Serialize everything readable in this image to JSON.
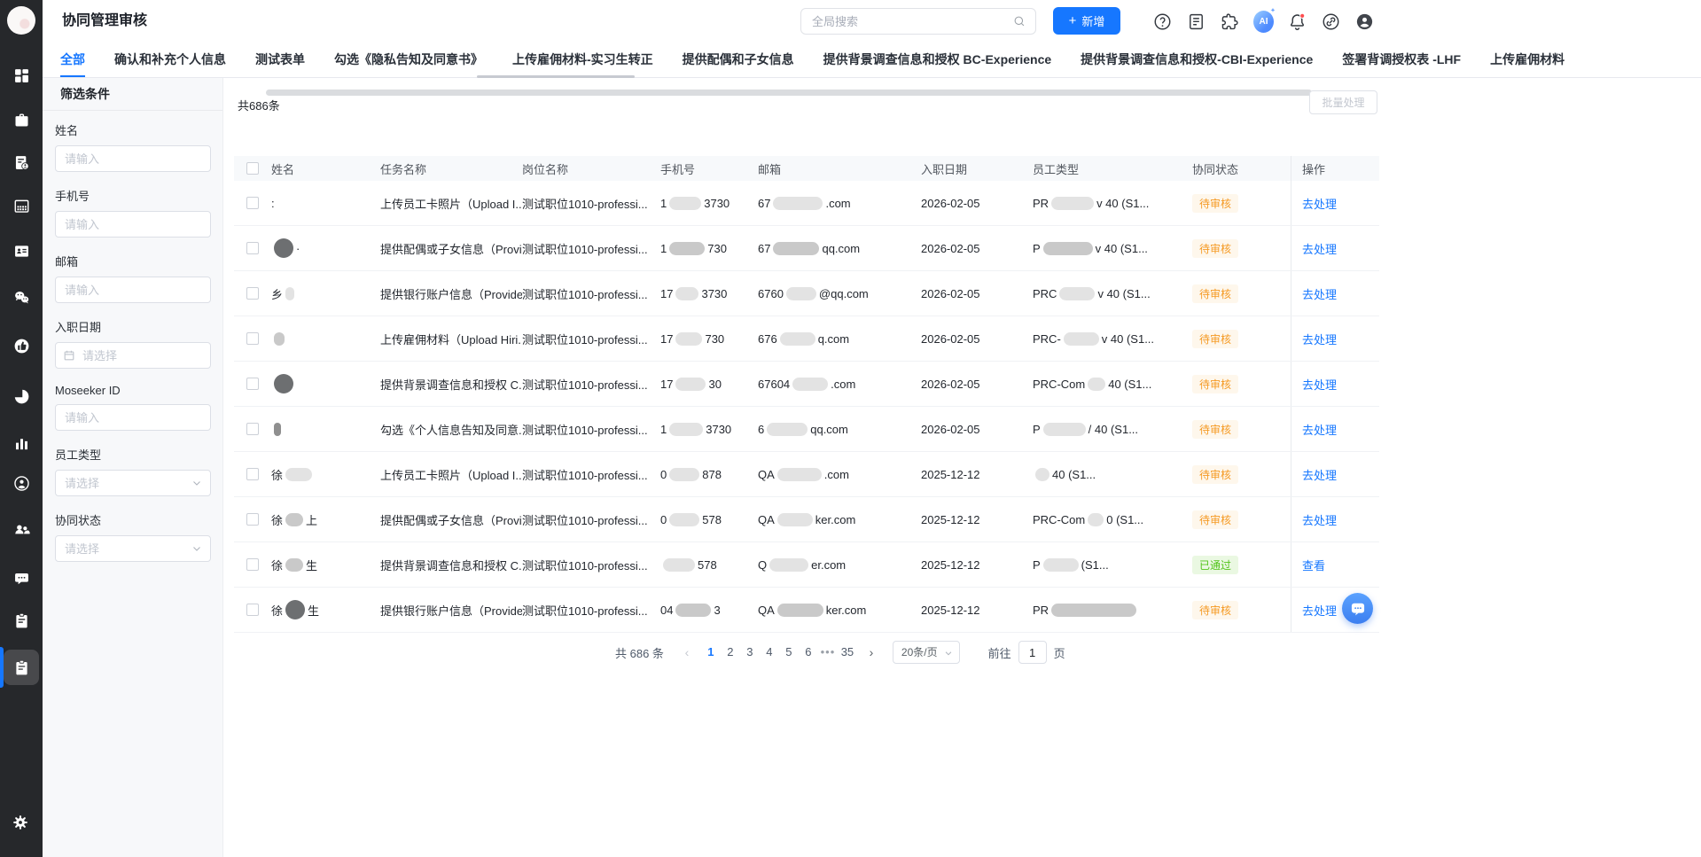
{
  "app": {
    "title": "协同管理审核"
  },
  "header": {
    "search": {
      "placeholder": "全局搜索"
    },
    "new_button": "新增",
    "ai_label": "AI",
    "icons": [
      "help",
      "document",
      "puzzle",
      "ai",
      "bell",
      "link",
      "user"
    ]
  },
  "sidebar": {
    "items": [
      {
        "name": "dashboard",
        "icon": "grid"
      },
      {
        "name": "positions",
        "icon": "briefcase"
      },
      {
        "name": "resumes",
        "icon": "doc-user"
      },
      {
        "name": "schedule",
        "icon": "calendar"
      },
      {
        "name": "id-card",
        "icon": "id-card"
      },
      {
        "name": "wechat",
        "icon": "wechat"
      },
      {
        "name": "endorsement",
        "icon": "thumb"
      },
      {
        "name": "pie-report",
        "icon": "pie"
      },
      {
        "name": "bar-report",
        "icon": "bars"
      },
      {
        "name": "candidate",
        "icon": "user-circle"
      },
      {
        "name": "talent-search",
        "icon": "users"
      },
      {
        "name": "messages",
        "icon": "chat"
      },
      {
        "name": "forms",
        "icon": "clipboard"
      },
      {
        "name": "approvals",
        "icon": "clipboard",
        "active": true
      }
    ],
    "bottom": {
      "name": "settings",
      "icon": "gear"
    }
  },
  "tabs": {
    "active_index": 0,
    "items": [
      "全部",
      "确认和补充个人信息",
      "测试表单",
      "勾选《隐私告知及同意书》",
      "上传雇佣材料-实习生转正",
      "提供配偶和子女信息",
      "提供背景调查信息和授权 BC-Experience",
      "提供背景调查信息和授权-CBI-Experience",
      "签署背调授权表 -LHF",
      "上传雇佣材料"
    ]
  },
  "filter": {
    "title": "筛选条件",
    "fields": [
      {
        "label": "姓名",
        "placeholder": "请输入",
        "type": "text"
      },
      {
        "label": "手机号",
        "placeholder": "请输入",
        "type": "text"
      },
      {
        "label": "邮箱",
        "placeholder": "请输入",
        "type": "text"
      },
      {
        "label": "入职日期",
        "placeholder": "请选择",
        "type": "date"
      },
      {
        "label": "Moseeker ID",
        "placeholder": "请输入",
        "type": "text"
      },
      {
        "label": "员工类型",
        "placeholder": "请选择",
        "type": "select"
      },
      {
        "label": "协同状态",
        "placeholder": "请选择",
        "type": "select"
      }
    ]
  },
  "table": {
    "total_text": "共686条",
    "batch_button": "批量处理",
    "columns": [
      "姓名",
      "任务名称",
      "岗位名称",
      "手机号",
      "邮箱",
      "入职日期",
      "员工类型",
      "协同状态",
      "操作"
    ],
    "status_kinds": {
      "待审核": "pending",
      "已通过": "passed"
    },
    "rows": [
      {
        "name": {
          "pre": ":"
        },
        "task": "上传员工卡照片（Upload I...",
        "position": "测试职位1010-professi...",
        "phone": {
          "pre": "1",
          "blob": 36,
          "post": "3730"
        },
        "email": {
          "pre": "67",
          "blob": 56,
          "post": ".com"
        },
        "hire_date": "2026-02-05",
        "employee_type": {
          "pre": "PR",
          "blob": 48,
          "post": "v 40 (S1..."
        },
        "status": "待审核",
        "action": "去处理"
      },
      {
        "name": {
          "blob": 22,
          "shape": "circle",
          "post": "·"
        },
        "task": "提供配偶或子女信息（Provi...",
        "position": "测试职位1010-professi...",
        "phone": {
          "pre": "1",
          "blob": 40,
          "post": "730",
          "shade": "mid"
        },
        "email": {
          "pre": "67",
          "blob": 52,
          "post": "qq.com",
          "shade": "mid"
        },
        "hire_date": "2026-02-05",
        "employee_type": {
          "pre": "P",
          "blob": 56,
          "post": "v 40 (S1...",
          "shade": "mid"
        },
        "status": "待审核",
        "action": "去处理"
      },
      {
        "name": {
          "pre": "乡",
          "blob": 10
        },
        "task": "提供银行账户信息（Provide...",
        "position": "测试职位1010-professi...",
        "phone": {
          "pre": "17",
          "blob": 26,
          "post": "3730"
        },
        "email": {
          "pre": "6760",
          "blob": 34,
          "post": "@qq.com"
        },
        "hire_date": "2026-02-05",
        "employee_type": {
          "pre": "PRC",
          "blob": 40,
          "post": "v 40 (S1..."
        },
        "status": "待审核",
        "action": "去处理"
      },
      {
        "name": {
          "blob": 12,
          "shade": "mid"
        },
        "task": "上传雇佣材料（Upload Hiri...",
        "position": "测试职位1010-professi...",
        "phone": {
          "pre": "17",
          "blob": 30,
          "post": "730"
        },
        "email": {
          "pre": "676",
          "blob": 40,
          "post": "q.com"
        },
        "hire_date": "2026-02-05",
        "employee_type": {
          "pre": "PRC-",
          "blob": 40,
          "post": "v 40 (S1..."
        },
        "status": "待审核",
        "action": "去处理"
      },
      {
        "name": {
          "blob": 18,
          "shape": "circle"
        },
        "task": "提供背景调查信息和授权 C...",
        "position": "测试职位1010-professi...",
        "phone": {
          "pre": "17",
          "blob": 34,
          "post": "30"
        },
        "email": {
          "pre": "67604",
          "blob": 40,
          "post": ".com"
        },
        "hire_date": "2026-02-05",
        "employee_type": {
          "pre": "PRC-Com",
          "blob": 20,
          "post": "40 (S1..."
        },
        "status": "待审核",
        "action": "去处理"
      },
      {
        "name": {
          "blob": 8,
          "shade": "dark"
        },
        "task": "勾选《个人信息告知及同意...",
        "position": "测试职位1010-professi...",
        "phone": {
          "pre": "1",
          "blob": 38,
          "post": "3730"
        },
        "email": {
          "pre": "6",
          "blob": 46,
          "post": "qq.com"
        },
        "hire_date": "2026-02-05",
        "employee_type": {
          "pre": "P",
          "blob": 48,
          "post": "/ 40 (S1..."
        },
        "status": "待审核",
        "action": "去处理"
      },
      {
        "name": {
          "pre": "徐",
          "blob": 30
        },
        "task": "上传员工卡照片（Upload I...",
        "position": "测试职位1010-professi...",
        "phone": {
          "pre": "0",
          "blob": 34,
          "post": "878"
        },
        "email": {
          "pre": "QA",
          "blob": 50,
          "post": ".com"
        },
        "hire_date": "2025-12-12",
        "employee_type": {
          "blob": 16,
          "post": "40 (S1..."
        },
        "status": "待审核",
        "action": "去处理"
      },
      {
        "name": {
          "pre": "徐",
          "blob": 20,
          "shade": "mid",
          "post": "上"
        },
        "task": "提供配偶或子女信息（Provi...",
        "position": "测试职位1010-professi...",
        "phone": {
          "pre": "0",
          "blob": 34,
          "post": "578"
        },
        "email": {
          "pre": "QA",
          "blob": 40,
          "post": "ker.com"
        },
        "hire_date": "2025-12-12",
        "employee_type": {
          "pre": "PRC-Com",
          "blob": 18,
          "post": "0 (S1..."
        },
        "status": "待审核",
        "action": "去处理"
      },
      {
        "name": {
          "pre": "徐",
          "blob": 20,
          "shade": "mid",
          "post": "生"
        },
        "task": "提供背景调查信息和授权 C...",
        "position": "测试职位1010-professi...",
        "phone": {
          "blob": 36,
          "post": "578"
        },
        "email": {
          "pre": "Q",
          "blob": 44,
          "post": "er.com"
        },
        "hire_date": "2025-12-12",
        "employee_type": {
          "pre": "P",
          "blob": 40,
          "post": "(S1..."
        },
        "status": "已通过",
        "action": "查看"
      },
      {
        "name": {
          "pre": "徐",
          "blob": 22,
          "shape": "circle",
          "post": "生"
        },
        "task": "提供银行账户信息（Provide...",
        "position": "测试职位1010-professi...",
        "phone": {
          "pre": "04",
          "blob": 40,
          "post": "3",
          "shade": "mid"
        },
        "email": {
          "pre": "QA",
          "blob": 52,
          "post": "ker.com",
          "shade": "mid"
        },
        "hire_date": "2025-12-12",
        "employee_type": {
          "pre": "PR",
          "blob": 96,
          "shade": "mid"
        },
        "status": "待审核",
        "action": "去处理"
      }
    ]
  },
  "pagination": {
    "total_text": "共 686 条",
    "pages": [
      "1",
      "2",
      "3",
      "4",
      "5",
      "6",
      "•••",
      "35"
    ],
    "active_page": "1",
    "page_size": "20条/页",
    "goto_label": "前往",
    "goto_value": "1",
    "goto_unit": "页"
  },
  "colors": {
    "accent": "#1677ff",
    "pending": "#f59a23",
    "passed": "#52c41a",
    "sidebar": "#26282b"
  }
}
